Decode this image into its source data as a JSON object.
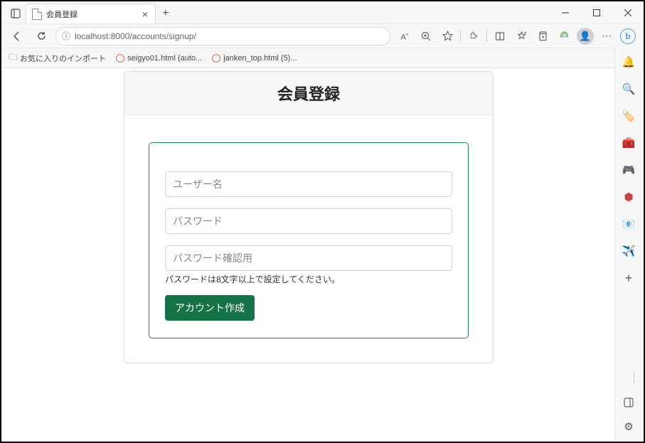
{
  "browser": {
    "tab_title": "会員登録",
    "url": "localhost:8000/accounts/signup/"
  },
  "bookmarks_bar": {
    "import_label": "お気に入りのインポート",
    "items": [
      {
        "label": "seigyo01.html (auto..."
      },
      {
        "label": "janken_top.html (5)..."
      }
    ]
  },
  "page": {
    "title": "会員登録",
    "form": {
      "username_placeholder": "ユーザー名",
      "password_placeholder": "パスワード",
      "password_confirm_placeholder": "パスワード確認用",
      "help_text": "パスワードは8文字以上で設定してください。",
      "submit_label": "アカウント作成"
    }
  }
}
